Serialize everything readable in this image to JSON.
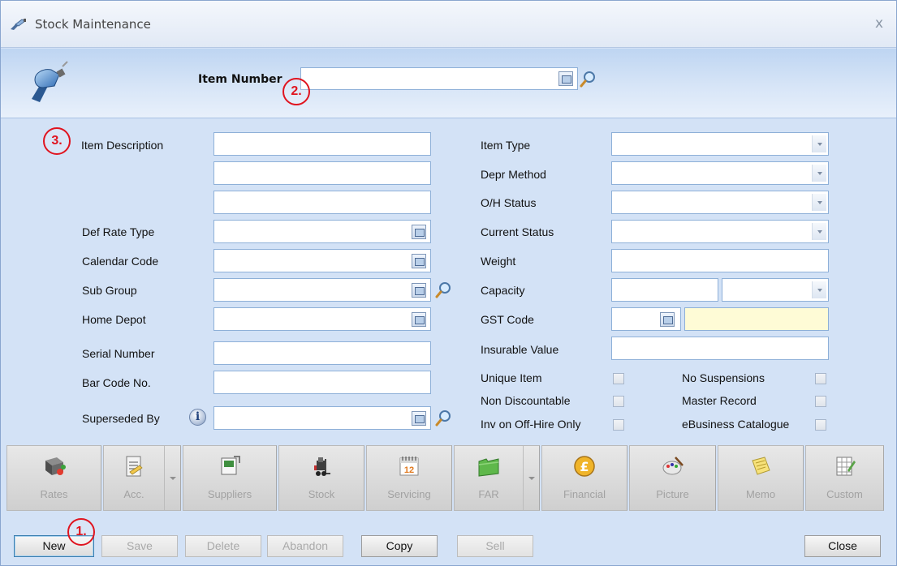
{
  "window": {
    "title": "Stock Maintenance",
    "close_glyph": "x"
  },
  "header": {
    "item_number_label": "Item Number",
    "item_number_value": ""
  },
  "markers": {
    "m1": "1.",
    "m2": "2.",
    "m3": "3."
  },
  "form": {
    "left": {
      "item_description": "Item Description",
      "def_rate_type": "Def Rate Type",
      "calendar_code": "Calendar Code",
      "sub_group": "Sub Group",
      "home_depot": "Home Depot",
      "serial_number": "Serial Number",
      "bar_code_no": "Bar Code No.",
      "superseded_by": "Superseded By"
    },
    "right": {
      "item_type": "Item Type",
      "depr_method": "Depr Method",
      "oh_status": "O/H Status",
      "current_status": "Current Status",
      "weight": "Weight",
      "capacity": "Capacity",
      "gst_code": "GST Code",
      "insurable_value": "Insurable Value"
    },
    "checkboxes": {
      "unique_item": "Unique Item",
      "non_discountable": "Non Discountable",
      "inv_on_off_hire_only": "Inv on Off-Hire Only",
      "no_suspensions": "No Suspensions",
      "master_record": "Master Record",
      "ebusiness_catalogue": "eBusiness Catalogue"
    },
    "info_glyph": "i"
  },
  "toolbar": [
    {
      "label": "Rates",
      "icon": "book-icon"
    },
    {
      "label": "Acc.",
      "icon": "document-icon"
    },
    {
      "label": "Suppliers",
      "icon": "suppliers-icon"
    },
    {
      "label": "Stock",
      "icon": "forklift-icon"
    },
    {
      "label": "Servicing",
      "icon": "calendar-icon",
      "calendar_day": "12"
    },
    {
      "label": "FAR",
      "icon": "folder-icon"
    },
    {
      "label": "Financial",
      "icon": "pound-coin-icon",
      "currency_glyph": "£"
    },
    {
      "label": "Picture",
      "icon": "palette-icon"
    },
    {
      "label": "Memo",
      "icon": "memo-icon"
    },
    {
      "label": "Custom",
      "icon": "custom-grid-icon"
    }
  ],
  "buttons": {
    "new": "New",
    "save": "Save",
    "delete": "Delete",
    "abandon": "Abandon",
    "copy": "Copy",
    "sell": "Sell",
    "close": "Close"
  },
  "colors": {
    "window_bg": "#d3e2f6",
    "marker_red": "#e0141f",
    "gst_field_bg": "#fefbd6"
  }
}
